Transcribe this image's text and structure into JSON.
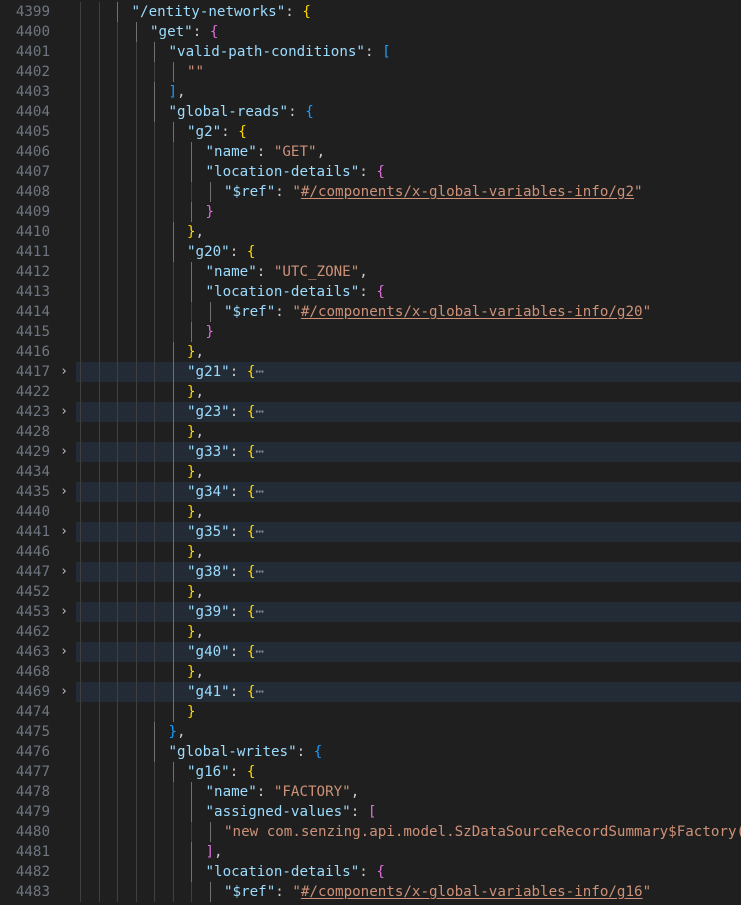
{
  "editor": {
    "fold_glyph": "›",
    "ellipsis": "⋯",
    "lines": [
      {
        "n": "4399",
        "indent": 3,
        "folded": false,
        "tokens": [
          {
            "t": "k",
            "v": "\"/entity-networks\""
          },
          {
            "t": "p",
            "v": ": "
          },
          {
            "t": "b1",
            "v": "{"
          }
        ]
      },
      {
        "n": "4400",
        "indent": 4,
        "folded": false,
        "tokens": [
          {
            "t": "k",
            "v": "\"get\""
          },
          {
            "t": "p",
            "v": ": "
          },
          {
            "t": "b2",
            "v": "{"
          }
        ]
      },
      {
        "n": "4401",
        "indent": 5,
        "folded": false,
        "tokens": [
          {
            "t": "k",
            "v": "\"valid-path-conditions\""
          },
          {
            "t": "p",
            "v": ": "
          },
          {
            "t": "b3",
            "v": "["
          }
        ]
      },
      {
        "n": "4402",
        "indent": 6,
        "folded": false,
        "tokens": [
          {
            "t": "s",
            "v": "\"\""
          }
        ]
      },
      {
        "n": "4403",
        "indent": 5,
        "folded": false,
        "tokens": [
          {
            "t": "b3",
            "v": "]"
          },
          {
            "t": "p",
            "v": ","
          }
        ]
      },
      {
        "n": "4404",
        "indent": 5,
        "folded": false,
        "tokens": [
          {
            "t": "k",
            "v": "\"global-reads\""
          },
          {
            "t": "p",
            "v": ": "
          },
          {
            "t": "b3",
            "v": "{"
          }
        ]
      },
      {
        "n": "4405",
        "indent": 6,
        "folded": false,
        "tokens": [
          {
            "t": "k",
            "v": "\"g2\""
          },
          {
            "t": "p",
            "v": ": "
          },
          {
            "t": "b1",
            "v": "{"
          }
        ]
      },
      {
        "n": "4406",
        "indent": 7,
        "folded": false,
        "tokens": [
          {
            "t": "k",
            "v": "\"name\""
          },
          {
            "t": "p",
            "v": ": "
          },
          {
            "t": "s",
            "v": "\"GET\""
          },
          {
            "t": "p",
            "v": ","
          }
        ]
      },
      {
        "n": "4407",
        "indent": 7,
        "folded": false,
        "tokens": [
          {
            "t": "k",
            "v": "\"location-details\""
          },
          {
            "t": "p",
            "v": ": "
          },
          {
            "t": "b2",
            "v": "{"
          }
        ]
      },
      {
        "n": "4408",
        "indent": 8,
        "folded": false,
        "tokens": [
          {
            "t": "k",
            "v": "\"$ref\""
          },
          {
            "t": "p",
            "v": ": "
          },
          {
            "t": "s",
            "v": "\""
          },
          {
            "t": "u",
            "v": "#/components/x-global-variables-info/g2"
          },
          {
            "t": "s",
            "v": "\""
          }
        ]
      },
      {
        "n": "4409",
        "indent": 7,
        "folded": false,
        "tokens": [
          {
            "t": "b2",
            "v": "}"
          }
        ]
      },
      {
        "n": "4410",
        "indent": 6,
        "folded": false,
        "tokens": [
          {
            "t": "b1",
            "v": "}"
          },
          {
            "t": "p",
            "v": ","
          }
        ]
      },
      {
        "n": "4411",
        "indent": 6,
        "folded": false,
        "tokens": [
          {
            "t": "k",
            "v": "\"g20\""
          },
          {
            "t": "p",
            "v": ": "
          },
          {
            "t": "b1",
            "v": "{"
          }
        ]
      },
      {
        "n": "4412",
        "indent": 7,
        "folded": false,
        "tokens": [
          {
            "t": "k",
            "v": "\"name\""
          },
          {
            "t": "p",
            "v": ": "
          },
          {
            "t": "s",
            "v": "\"UTC_ZONE\""
          },
          {
            "t": "p",
            "v": ","
          }
        ]
      },
      {
        "n": "4413",
        "indent": 7,
        "folded": false,
        "tokens": [
          {
            "t": "k",
            "v": "\"location-details\""
          },
          {
            "t": "p",
            "v": ": "
          },
          {
            "t": "b2",
            "v": "{"
          }
        ]
      },
      {
        "n": "4414",
        "indent": 8,
        "folded": false,
        "tokens": [
          {
            "t": "k",
            "v": "\"$ref\""
          },
          {
            "t": "p",
            "v": ": "
          },
          {
            "t": "s",
            "v": "\""
          },
          {
            "t": "u",
            "v": "#/components/x-global-variables-info/g20"
          },
          {
            "t": "s",
            "v": "\""
          }
        ]
      },
      {
        "n": "4415",
        "indent": 7,
        "folded": false,
        "tokens": [
          {
            "t": "b2",
            "v": "}"
          }
        ]
      },
      {
        "n": "4416",
        "indent": 6,
        "folded": false,
        "tokens": [
          {
            "t": "b1",
            "v": "}"
          },
          {
            "t": "p",
            "v": ","
          }
        ]
      },
      {
        "n": "4417",
        "indent": 6,
        "folded": true,
        "tokens": [
          {
            "t": "k",
            "v": "\"g21\""
          },
          {
            "t": "p",
            "v": ": "
          },
          {
            "t": "b1",
            "v": "{"
          },
          {
            "t": "dots",
            "v": "⋯"
          }
        ]
      },
      {
        "n": "4422",
        "indent": 6,
        "folded": false,
        "tokens": [
          {
            "t": "b1",
            "v": "}"
          },
          {
            "t": "p",
            "v": ","
          }
        ]
      },
      {
        "n": "4423",
        "indent": 6,
        "folded": true,
        "tokens": [
          {
            "t": "k",
            "v": "\"g23\""
          },
          {
            "t": "p",
            "v": ": "
          },
          {
            "t": "b1",
            "v": "{"
          },
          {
            "t": "dots",
            "v": "⋯"
          }
        ]
      },
      {
        "n": "4428",
        "indent": 6,
        "folded": false,
        "tokens": [
          {
            "t": "b1",
            "v": "}"
          },
          {
            "t": "p",
            "v": ","
          }
        ]
      },
      {
        "n": "4429",
        "indent": 6,
        "folded": true,
        "tokens": [
          {
            "t": "k",
            "v": "\"g33\""
          },
          {
            "t": "p",
            "v": ": "
          },
          {
            "t": "b1",
            "v": "{"
          },
          {
            "t": "dots",
            "v": "⋯"
          }
        ]
      },
      {
        "n": "4434",
        "indent": 6,
        "folded": false,
        "tokens": [
          {
            "t": "b1",
            "v": "}"
          },
          {
            "t": "p",
            "v": ","
          }
        ]
      },
      {
        "n": "4435",
        "indent": 6,
        "folded": true,
        "tokens": [
          {
            "t": "k",
            "v": "\"g34\""
          },
          {
            "t": "p",
            "v": ": "
          },
          {
            "t": "b1",
            "v": "{"
          },
          {
            "t": "dots",
            "v": "⋯"
          }
        ]
      },
      {
        "n": "4440",
        "indent": 6,
        "folded": false,
        "tokens": [
          {
            "t": "b1",
            "v": "}"
          },
          {
            "t": "p",
            "v": ","
          }
        ]
      },
      {
        "n": "4441",
        "indent": 6,
        "folded": true,
        "tokens": [
          {
            "t": "k",
            "v": "\"g35\""
          },
          {
            "t": "p",
            "v": ": "
          },
          {
            "t": "b1",
            "v": "{"
          },
          {
            "t": "dots",
            "v": "⋯"
          }
        ]
      },
      {
        "n": "4446",
        "indent": 6,
        "folded": false,
        "tokens": [
          {
            "t": "b1",
            "v": "}"
          },
          {
            "t": "p",
            "v": ","
          }
        ]
      },
      {
        "n": "4447",
        "indent": 6,
        "folded": true,
        "tokens": [
          {
            "t": "k",
            "v": "\"g38\""
          },
          {
            "t": "p",
            "v": ": "
          },
          {
            "t": "b1",
            "v": "{"
          },
          {
            "t": "dots",
            "v": "⋯"
          }
        ]
      },
      {
        "n": "4452",
        "indent": 6,
        "folded": false,
        "tokens": [
          {
            "t": "b1",
            "v": "}"
          },
          {
            "t": "p",
            "v": ","
          }
        ]
      },
      {
        "n": "4453",
        "indent": 6,
        "folded": true,
        "tokens": [
          {
            "t": "k",
            "v": "\"g39\""
          },
          {
            "t": "p",
            "v": ": "
          },
          {
            "t": "b1",
            "v": "{"
          },
          {
            "t": "dots",
            "v": "⋯"
          }
        ]
      },
      {
        "n": "4462",
        "indent": 6,
        "folded": false,
        "tokens": [
          {
            "t": "b1",
            "v": "}"
          },
          {
            "t": "p",
            "v": ","
          }
        ]
      },
      {
        "n": "4463",
        "indent": 6,
        "folded": true,
        "tokens": [
          {
            "t": "k",
            "v": "\"g40\""
          },
          {
            "t": "p",
            "v": ": "
          },
          {
            "t": "b1",
            "v": "{"
          },
          {
            "t": "dots",
            "v": "⋯"
          }
        ]
      },
      {
        "n": "4468",
        "indent": 6,
        "folded": false,
        "tokens": [
          {
            "t": "b1",
            "v": "}"
          },
          {
            "t": "p",
            "v": ","
          }
        ]
      },
      {
        "n": "4469",
        "indent": 6,
        "folded": true,
        "tokens": [
          {
            "t": "k",
            "v": "\"g41\""
          },
          {
            "t": "p",
            "v": ": "
          },
          {
            "t": "b1",
            "v": "{"
          },
          {
            "t": "dots",
            "v": "⋯"
          }
        ]
      },
      {
        "n": "4474",
        "indent": 6,
        "folded": false,
        "tokens": [
          {
            "t": "b1",
            "v": "}"
          }
        ]
      },
      {
        "n": "4475",
        "indent": 5,
        "folded": false,
        "tokens": [
          {
            "t": "b3",
            "v": "}"
          },
          {
            "t": "p",
            "v": ","
          }
        ]
      },
      {
        "n": "4476",
        "indent": 5,
        "folded": false,
        "tokens": [
          {
            "t": "k",
            "v": "\"global-writes\""
          },
          {
            "t": "p",
            "v": ": "
          },
          {
            "t": "b3",
            "v": "{"
          }
        ]
      },
      {
        "n": "4477",
        "indent": 6,
        "folded": false,
        "tokens": [
          {
            "t": "k",
            "v": "\"g16\""
          },
          {
            "t": "p",
            "v": ": "
          },
          {
            "t": "b1",
            "v": "{"
          }
        ]
      },
      {
        "n": "4478",
        "indent": 7,
        "folded": false,
        "tokens": [
          {
            "t": "k",
            "v": "\"name\""
          },
          {
            "t": "p",
            "v": ": "
          },
          {
            "t": "s",
            "v": "\"FACTORY\""
          },
          {
            "t": "p",
            "v": ","
          }
        ]
      },
      {
        "n": "4479",
        "indent": 7,
        "folded": false,
        "tokens": [
          {
            "t": "k",
            "v": "\"assigned-values\""
          },
          {
            "t": "p",
            "v": ": "
          },
          {
            "t": "b2",
            "v": "["
          }
        ]
      },
      {
        "n": "4480",
        "indent": 8,
        "folded": false,
        "tokens": [
          {
            "t": "s",
            "v": "\"new com.senzing.api.model.SzDataSourceRecordSummary$Factory()\""
          }
        ]
      },
      {
        "n": "4481",
        "indent": 7,
        "folded": false,
        "tokens": [
          {
            "t": "b2",
            "v": "]"
          },
          {
            "t": "p",
            "v": ","
          }
        ]
      },
      {
        "n": "4482",
        "indent": 7,
        "folded": false,
        "tokens": [
          {
            "t": "k",
            "v": "\"location-details\""
          },
          {
            "t": "p",
            "v": ": "
          },
          {
            "t": "b2",
            "v": "{"
          }
        ]
      },
      {
        "n": "4483",
        "indent": 8,
        "folded": false,
        "tokens": [
          {
            "t": "k",
            "v": "\"$ref\""
          },
          {
            "t": "p",
            "v": ": "
          },
          {
            "t": "s",
            "v": "\""
          },
          {
            "t": "u",
            "v": "#/components/x-global-variables-info/g16"
          },
          {
            "t": "s",
            "v": "\""
          }
        ]
      }
    ]
  }
}
